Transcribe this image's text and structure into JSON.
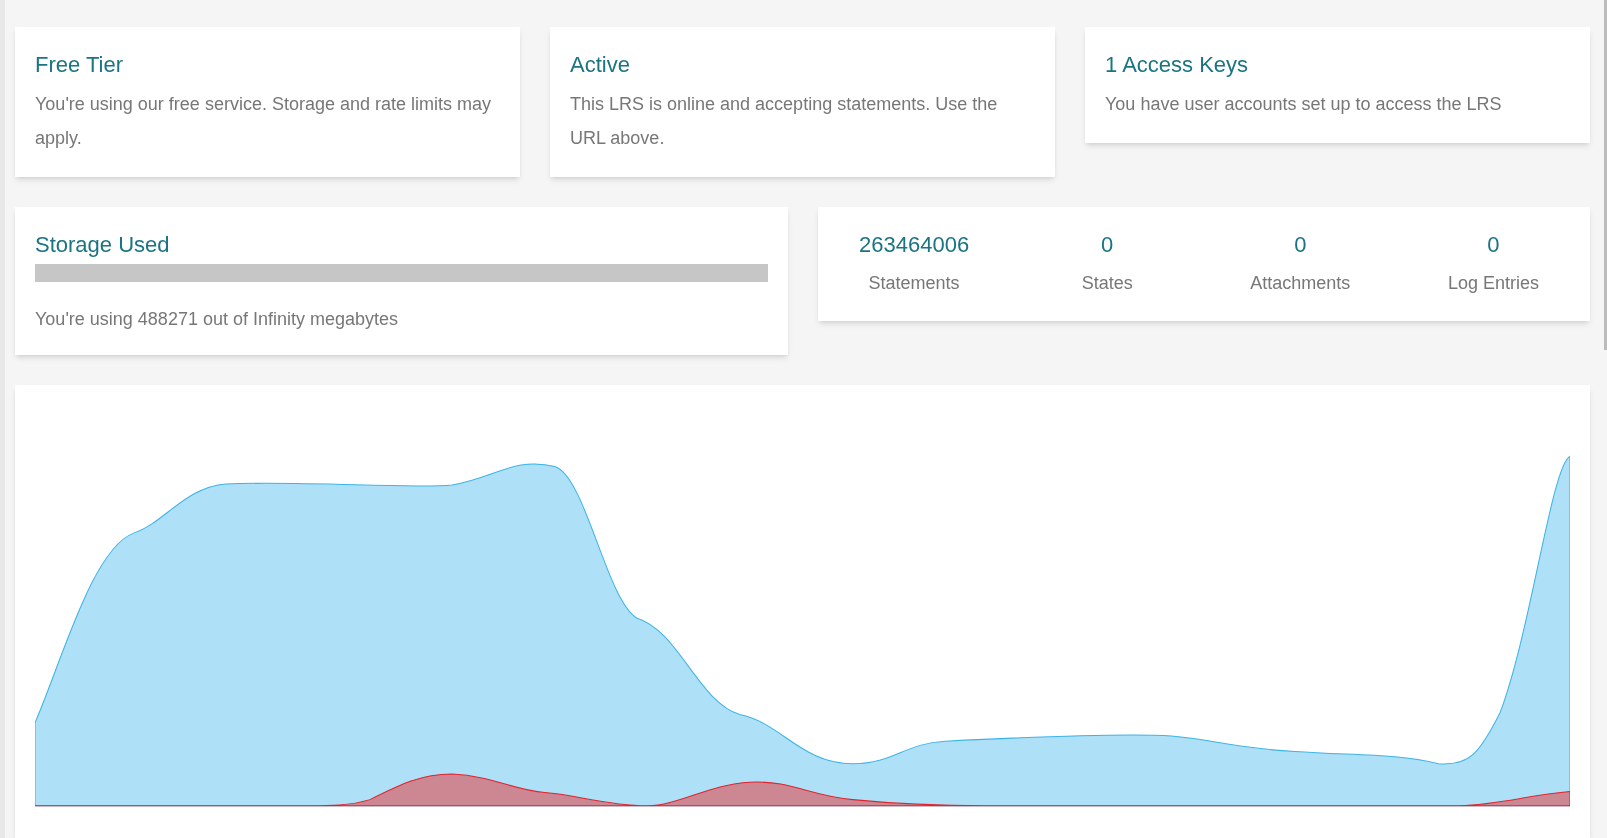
{
  "status_cards": [
    {
      "title": "Free Tier",
      "text": "You're using our free service. Storage and rate limits may apply."
    },
    {
      "title": "Active",
      "text": "This LRS is online and accepting statements. Use the URL above."
    },
    {
      "title": "1 Access Keys",
      "text": "You have user accounts set up to access the LRS"
    }
  ],
  "storage": {
    "title": "Storage Used",
    "level": 0,
    "text": "You're using 488271 out of Infinity megabytes"
  },
  "stats": [
    {
      "value": "263464006",
      "label": "Statements"
    },
    {
      "value": "0",
      "label": "States"
    },
    {
      "value": "0",
      "label": "Attachments"
    },
    {
      "value": "0",
      "label": "Log Entries"
    }
  ]
}
